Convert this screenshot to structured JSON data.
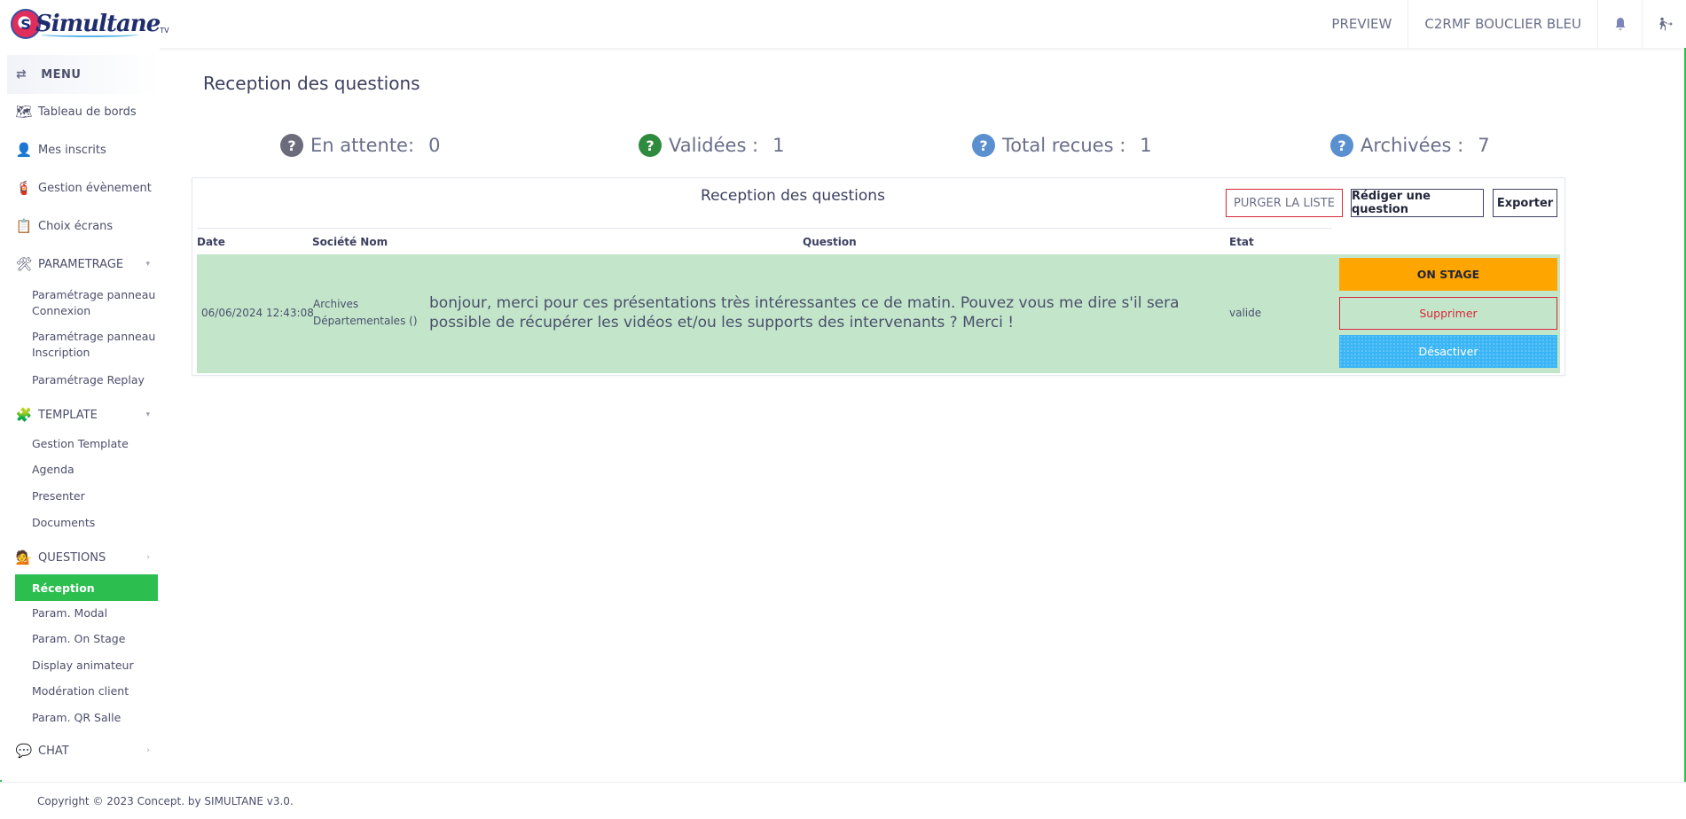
{
  "header": {
    "logo_text": "Simultane",
    "logo_sub": "TV",
    "logo_badge": "S",
    "nav": [
      "PREVIEW",
      "C2RMF BOUCLIER BLEU"
    ],
    "bell_icon": "🔔",
    "logout_icon": "🏃"
  },
  "sidebar": {
    "menu_label": "MENU",
    "menu_icon": "⇄",
    "items": [
      {
        "label": "Tableau de bords",
        "icon": "🗺"
      },
      {
        "label": "Mes inscrits",
        "icon": "👤"
      },
      {
        "label": "Gestion évènement",
        "icon": "🧯"
      },
      {
        "label": "Choix écrans",
        "icon": "📋"
      },
      {
        "label": "PARAMETRAGE",
        "icon": "🛠",
        "caret": "▾"
      },
      {
        "label": "TEMPLATE",
        "icon": "🧩",
        "caret": "▾"
      },
      {
        "label": "QUESTIONS",
        "icon": "💁",
        "caret": "›"
      },
      {
        "label": "CHAT",
        "icon": "💬",
        "caret": "›"
      }
    ],
    "param_sub": [
      "Paramétrage panneau Connexion",
      "Paramétrage panneau Inscription",
      "Paramétrage Replay"
    ],
    "template_sub": [
      "Gestion Template",
      "Agenda",
      "Presenter",
      "Documents"
    ],
    "questions_active": "Réception",
    "questions_sub": [
      "Param. Modal",
      "Param. On Stage",
      "Display animateur",
      "Modération client",
      "Param. QR Salle"
    ]
  },
  "main": {
    "page_title": "Reception des questions",
    "stats": [
      {
        "label": "En attente:",
        "value": "0",
        "color": "#6b6b7b",
        "icon": "?"
      },
      {
        "label": "Validées :",
        "value": "1",
        "color": "#2e8b3e",
        "icon": "?"
      },
      {
        "label": "Total recues :",
        "value": "1",
        "color": "#5a8fd0",
        "icon": "?"
      },
      {
        "label": "Archivées :",
        "value": "7",
        "color": "#5a8fd0",
        "icon": "?"
      }
    ],
    "card_title": "Reception des questions",
    "buttons": {
      "purge": "PURGER LA LISTE",
      "rediger": "Rédiger une question",
      "exporter": "Exporter"
    },
    "columns": [
      "Date",
      "Société Nom",
      "Question",
      "Etat"
    ],
    "rows": [
      {
        "date": "06/06/2024 12:43:08",
        "societe_line1": "Archives",
        "societe_line2": "Départementales ()",
        "question": "bonjour, merci pour ces présentations très intéressantes ce de matin. Pouvez vous me dire s'il sera possible de récupérer les vidéos et/ou les supports des intervenants ? Merci !",
        "etat": "valide",
        "actions": {
          "on_stage": "ON STAGE",
          "supprimer": "Supprimer",
          "desactiver": "Désactiver"
        }
      }
    ]
  },
  "footer": {
    "copyright": "Copyright © 2023 Concept. by SIMULTANE v3.0."
  },
  "colors": {
    "active_green": "#2cbf4f",
    "row_green": "#c3e6cb",
    "on_stage": "#ffa500",
    "desactiver": "#3ab5f5",
    "danger": "#d9263a"
  }
}
